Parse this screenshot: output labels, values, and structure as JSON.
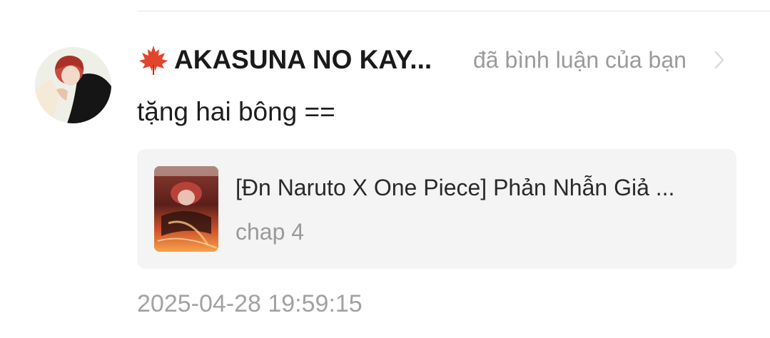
{
  "notification": {
    "username": "AKASUNA NO KAY...",
    "action": "đã bình luận của bạn",
    "comment": "tặng hai bông ==",
    "timestamp": "2025-04-28 19:59:15",
    "avatar_icon": "user-avatar",
    "username_prefix_icon": "maple-leaf-icon",
    "more_icon": "chevron-right-icon"
  },
  "story": {
    "title": "[Đn Naruto X One Piece] Phản Nhẫn Giả ...",
    "chapter": "chap 4",
    "cover_icon": "story-cover-image"
  },
  "colors": {
    "background": "#ffffff",
    "primary_text": "#1a1a1a",
    "secondary_text": "#9a9a9a",
    "card_background": "#f4f4f5",
    "leaf": "#e3452b"
  }
}
